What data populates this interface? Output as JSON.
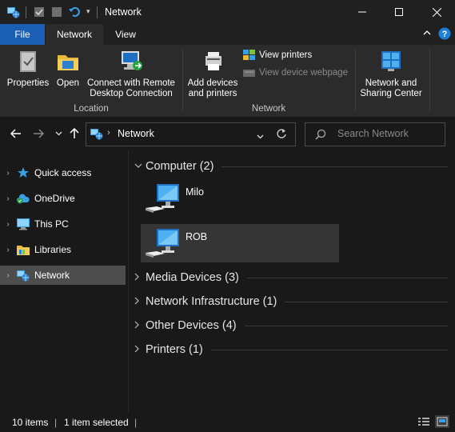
{
  "window": {
    "title": "Network"
  },
  "ribbon_tabs": {
    "file": "File",
    "network": "Network",
    "view": "View"
  },
  "ribbon": {
    "properties": "Properties",
    "open": "Open",
    "connect_rdp_line1": "Connect with Remote",
    "connect_rdp_line2": "Desktop Connection",
    "location_group": "Location",
    "add_devices_line1": "Add devices",
    "add_devices_line2": "and printers",
    "view_printers": "View printers",
    "view_device_webpage": "View device webpage",
    "network_group": "Network",
    "sharing_center_line1": "Network and",
    "sharing_center_line2": "Sharing Center"
  },
  "address": {
    "breadcrumb": "Network",
    "search_placeholder": "Search Network"
  },
  "sidebar": {
    "items": [
      {
        "label": "Quick access"
      },
      {
        "label": "OneDrive"
      },
      {
        "label": "This PC"
      },
      {
        "label": "Libraries"
      },
      {
        "label": "Network"
      }
    ]
  },
  "groups": {
    "computer": "Computer (2)",
    "media": "Media Devices (3)",
    "infra": "Network Infrastructure (1)",
    "other": "Other Devices (4)",
    "printers": "Printers (1)"
  },
  "computers": [
    {
      "name": "Milo"
    },
    {
      "name": "ROB"
    }
  ],
  "status": {
    "items": "10 items",
    "selected": "1 item selected"
  },
  "colors": {
    "accent": "#1a5fb4",
    "background": "#191919",
    "ribbon": "#2b2b2b",
    "selection": "#4d4d4d"
  }
}
